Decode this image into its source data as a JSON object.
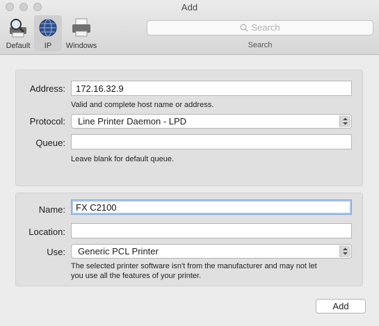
{
  "window": {
    "title": "Add"
  },
  "toolbar": {
    "items": [
      {
        "label": "Default",
        "icon": "magnifier-printer-icon"
      },
      {
        "label": "IP",
        "icon": "globe-icon",
        "active": true
      },
      {
        "label": "Windows",
        "icon": "printer-icon"
      }
    ],
    "search": {
      "placeholder": "Search",
      "caption": "Search"
    }
  },
  "ip_panel": {
    "address": {
      "label": "Address:",
      "value": "172.16.32.9",
      "hint": "Valid and complete host name or address."
    },
    "protocol": {
      "label": "Protocol:",
      "value": "Line Printer Daemon - LPD"
    },
    "queue": {
      "label": "Queue:",
      "value": "",
      "hint": "Leave blank for default queue."
    }
  },
  "printer_panel": {
    "name": {
      "label": "Name:",
      "value": "FX C2100"
    },
    "location": {
      "label": "Location:",
      "value": ""
    },
    "use": {
      "label": "Use:",
      "value": "Generic PCL Printer",
      "hint_line1": "The selected printer software isn't from the manufacturer and may not let",
      "hint_line2": "you use all the features of your printer."
    }
  },
  "buttons": {
    "add": "Add"
  }
}
